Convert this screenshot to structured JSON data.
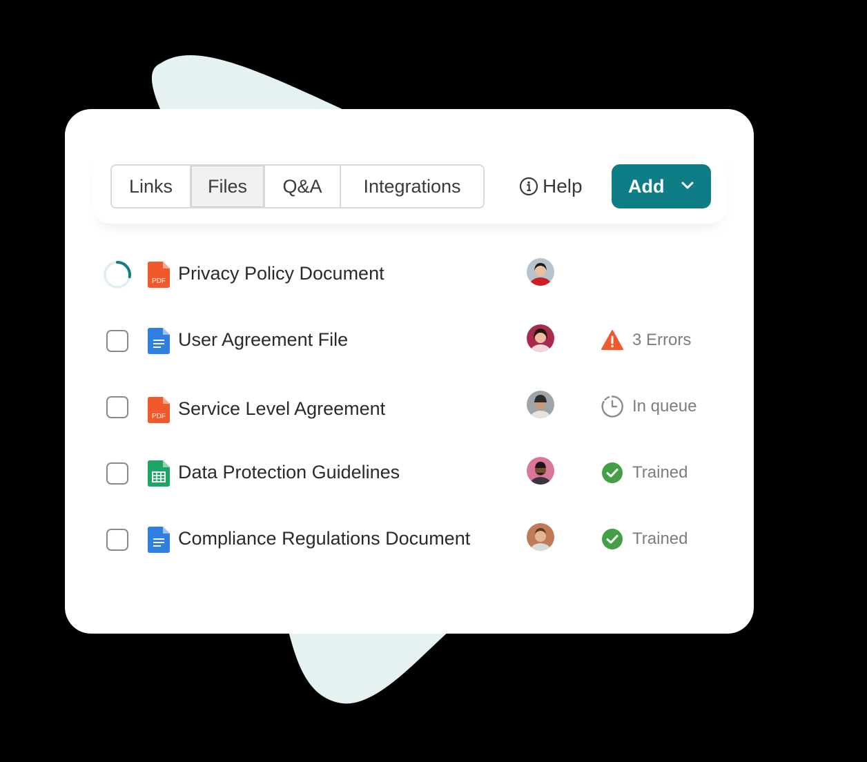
{
  "tabs": [
    {
      "label": "Links",
      "active": false
    },
    {
      "label": "Files",
      "active": true
    },
    {
      "label": "Q&A",
      "active": false
    },
    {
      "label": "Integrations",
      "active": false
    }
  ],
  "help": {
    "label": "Help",
    "icon": "info-circle-icon"
  },
  "add_button": {
    "label": "Add",
    "icon": "chevron-down-icon",
    "color": "#0e7d86"
  },
  "files": [
    {
      "name": "Privacy Policy Document",
      "type": "pdf",
      "selector": "loading-spinner",
      "status": "",
      "status_icon": ""
    },
    {
      "name": "User Agreement File",
      "type": "doc",
      "selector": "checkbox",
      "status": "3 Errors",
      "status_icon": "warning-icon"
    },
    {
      "name": "Service Level Agreement",
      "type": "pdf",
      "selector": "checkbox",
      "status": "In queue",
      "status_icon": "clock-icon"
    },
    {
      "name": "Data Protection Guidelines",
      "type": "sheet",
      "selector": "checkbox",
      "status": "Trained",
      "status_icon": "check-circle-icon"
    },
    {
      "name": "Compliance Regulations Document",
      "type": "doc",
      "selector": "checkbox",
      "status": "Trained",
      "status_icon": "check-circle-icon"
    }
  ],
  "colors": {
    "accent": "#0e7d86",
    "pdf": "#f0592b",
    "doc": "#2f7fe0",
    "sheet": "#20a463",
    "error": "#f0592b",
    "success": "#43a047"
  }
}
